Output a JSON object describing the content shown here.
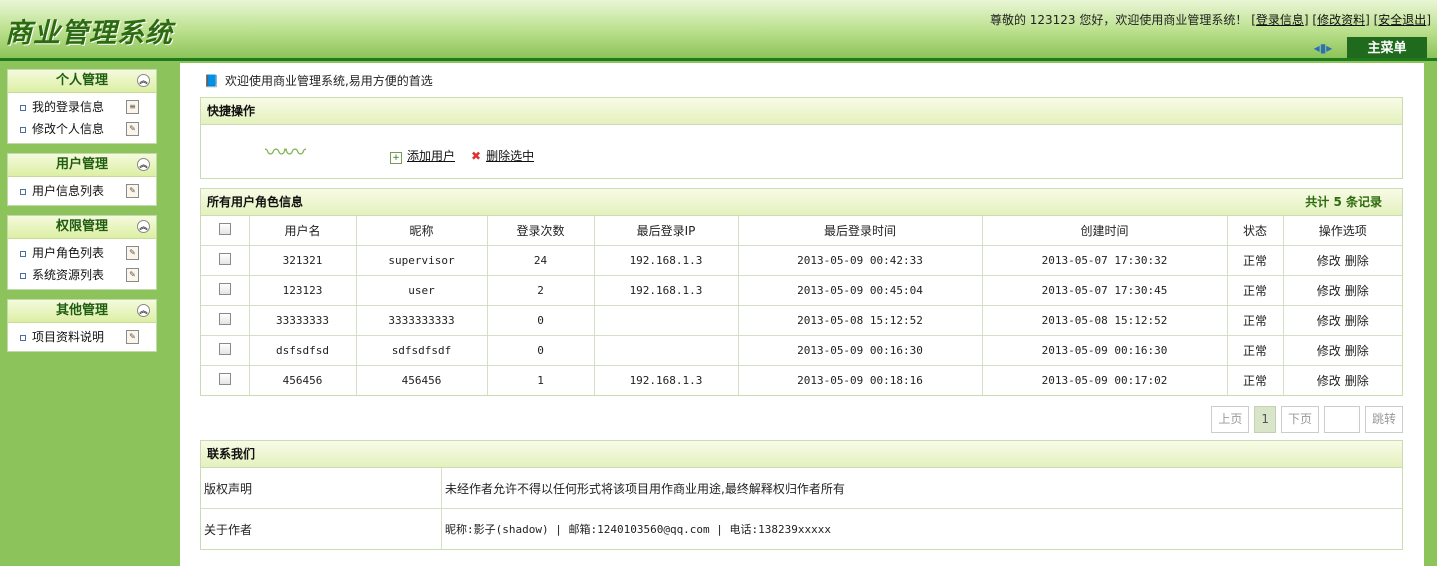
{
  "header": {
    "title": "商业管理系统",
    "welcome_text": "尊敬的 123123 您好，欢迎使用商业管理系统！",
    "links": [
      "登录信息",
      "修改资料",
      "安全退出"
    ],
    "main_menu_tab": "主菜单"
  },
  "sidebar": {
    "groups": [
      {
        "title": "个人管理",
        "items": [
          "我的登录信息",
          "修改个人信息"
        ]
      },
      {
        "title": "用户管理",
        "items": [
          "用户信息列表"
        ]
      },
      {
        "title": "权限管理",
        "items": [
          "用户角色列表",
          "系统资源列表"
        ]
      },
      {
        "title": "其他管理",
        "items": [
          "项目资料说明"
        ]
      }
    ]
  },
  "main": {
    "intro": "欢迎使用商业管理系统,易用方便的首选",
    "quick": {
      "title": "快捷操作",
      "add_label": "添加用户",
      "delete_label": "删除选中"
    },
    "users": {
      "title": "所有用户角色信息",
      "count_text": "共计 5 条记录",
      "columns": [
        "用户名",
        "昵称",
        "登录次数",
        "最后登录IP",
        "最后登录时间",
        "创建时间",
        "状态",
        "操作选项"
      ],
      "rows": [
        {
          "username": "321321",
          "nickname": "supervisor",
          "logins": "24",
          "ip": "192.168.1.3",
          "last_login": "2013-05-09 00:42:33",
          "created": "2013-05-07 17:30:32",
          "status": "正常"
        },
        {
          "username": "123123",
          "nickname": "user",
          "logins": "2",
          "ip": "192.168.1.3",
          "last_login": "2013-05-09 00:45:04",
          "created": "2013-05-07 17:30:45",
          "status": "正常"
        },
        {
          "username": "33333333",
          "nickname": "3333333333",
          "logins": "0",
          "ip": "",
          "last_login": "2013-05-08 15:12:52",
          "created": "2013-05-08 15:12:52",
          "status": "正常"
        },
        {
          "username": "dsfsdfsd",
          "nickname": "sdfsdfsdf",
          "logins": "0",
          "ip": "",
          "last_login": "2013-05-09 00:16:30",
          "created": "2013-05-09 00:16:30",
          "status": "正常"
        },
        {
          "username": "456456",
          "nickname": "456456",
          "logins": "1",
          "ip": "192.168.1.3",
          "last_login": "2013-05-09 00:18:16",
          "created": "2013-05-09 00:17:02",
          "status": "正常"
        }
      ],
      "op_edit": "修改",
      "op_delete": "删除"
    },
    "pager": {
      "prev": "上页",
      "current": "1",
      "next": "下页",
      "jump": "跳转"
    },
    "contact": {
      "title": "联系我们",
      "rows": [
        {
          "label": "版权声明",
          "value": "未经作者允许不得以任何形式将该项目用作商业用途,最终解释权归作者所有"
        },
        {
          "label": "关于作者",
          "value": "昵称:影子(shadow) | 邮箱:1240103560@qq.com | 电话:138239xxxxx"
        }
      ]
    }
  }
}
